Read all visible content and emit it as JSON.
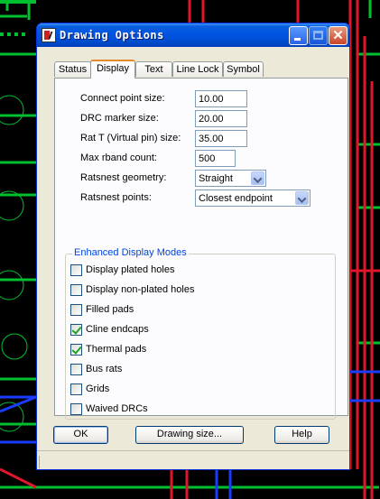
{
  "window": {
    "title": "Drawing Options",
    "buttons": {
      "minimize": "minimize",
      "maximize": "maximize",
      "close": "✕"
    }
  },
  "tabs": [
    "Status",
    "Display",
    "Text",
    "Line Lock",
    "Symbol"
  ],
  "active_tab": "Display",
  "fields": [
    {
      "label": "Connect point size:",
      "value": "10.00"
    },
    {
      "label": "DRC marker size:",
      "value": "20.00"
    },
    {
      "label": "Rat T (Virtual pin) size:",
      "value": "35.00"
    },
    {
      "label": "Max rband count:",
      "value": "500"
    }
  ],
  "selects": [
    {
      "label": "Ratsnest geometry:",
      "value": "Straight"
    },
    {
      "label": "Ratsnest points:",
      "value": "Closest endpoint"
    }
  ],
  "group": {
    "title": "Enhanced Display Modes",
    "options": [
      {
        "label": "Display plated holes",
        "checked": false
      },
      {
        "label": "Display non-plated holes",
        "checked": false
      },
      {
        "label": "Filled pads",
        "checked": false
      },
      {
        "label": "Cline endcaps",
        "checked": true
      },
      {
        "label": "Thermal pads",
        "checked": true
      },
      {
        "label": "Bus rats",
        "checked": false
      },
      {
        "label": "Grids",
        "checked": false
      },
      {
        "label": "Waived DRCs",
        "checked": false
      }
    ]
  },
  "buttons": {
    "ok": "OK",
    "drawing_size": "Drawing size...",
    "help": "Help"
  },
  "colors": {
    "title_bar": "#0054e3",
    "dialog_bg": "#ece9d8",
    "group_title": "#0046d5",
    "check": "#21a121",
    "pcb_bg": "#000000",
    "trace_green": "#00c030",
    "trace_red": "#e0162b",
    "trace_blue": "#1a3cff"
  }
}
